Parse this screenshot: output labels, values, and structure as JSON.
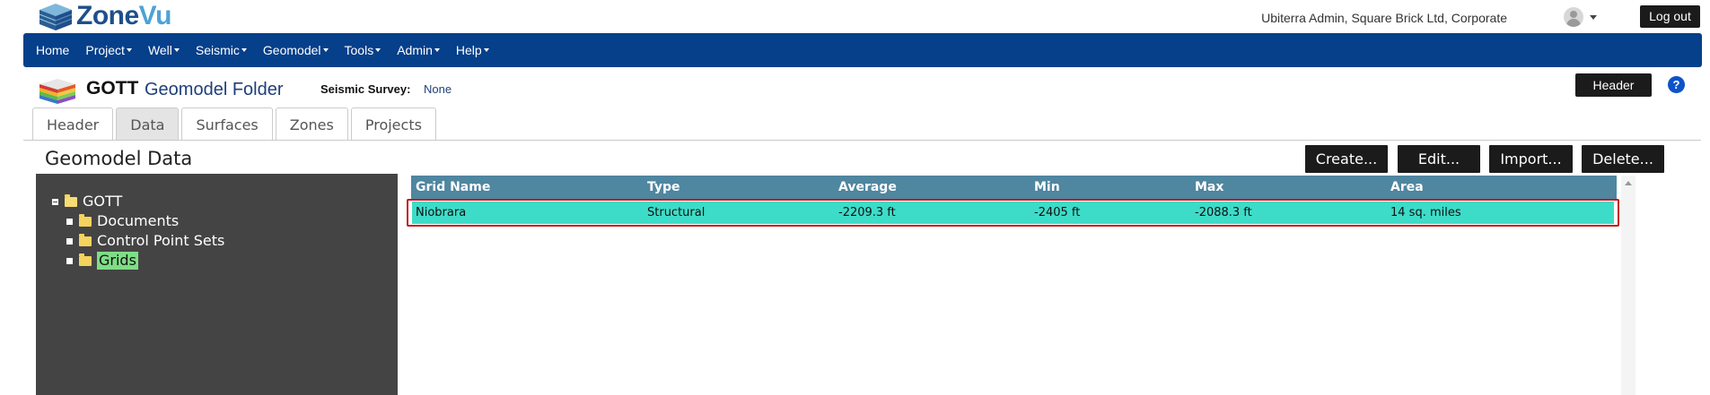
{
  "app": {
    "logo_primary": "Zone",
    "logo_secondary": "Vu"
  },
  "user": {
    "display": "Ubiterra Admin, Square Brick Ltd, Corporate",
    "logout_label": "Log out"
  },
  "nav": {
    "items": [
      {
        "label": "Home",
        "dropdown": false
      },
      {
        "label": "Project",
        "dropdown": true
      },
      {
        "label": "Well",
        "dropdown": true
      },
      {
        "label": "Seismic",
        "dropdown": true
      },
      {
        "label": "Geomodel",
        "dropdown": true
      },
      {
        "label": "Tools",
        "dropdown": true
      },
      {
        "label": "Admin",
        "dropdown": true
      },
      {
        "label": "Help",
        "dropdown": true
      }
    ],
    "bar_color": "#063f8a"
  },
  "object": {
    "name": "GOTT",
    "type": "Geomodel Folder",
    "seismic_survey_label": "Seismic Survey:",
    "seismic_survey_value": "None",
    "header_button": "Header",
    "help_icon": "?"
  },
  "tabs": [
    {
      "label": "Header",
      "active": false
    },
    {
      "label": "Data",
      "active": true
    },
    {
      "label": "Surfaces",
      "active": false
    },
    {
      "label": "Zones",
      "active": false
    },
    {
      "label": "Projects",
      "active": false
    }
  ],
  "section": {
    "title": "Geomodel Data",
    "buttons": {
      "create": "Create...",
      "edit": "Edit...",
      "import": "Import...",
      "delete": "Delete..."
    }
  },
  "tree": {
    "root": "GOTT",
    "children": [
      {
        "label": "Documents",
        "selected": false
      },
      {
        "label": "Control Point Sets",
        "selected": false
      },
      {
        "label": "Grids",
        "selected": true
      }
    ]
  },
  "grid": {
    "columns": [
      "Grid Name",
      "Type",
      "Average",
      "Min",
      "Max",
      "Area"
    ],
    "rows": [
      [
        "Niobrara",
        "Structural",
        "-2209.3 ft",
        "-2405 ft",
        "-2088.3 ft",
        "14 sq. miles"
      ]
    ],
    "header_color": "#4f86a0",
    "selected_row_color": "#3ddcc8",
    "highlight_color": "#c4171c"
  }
}
